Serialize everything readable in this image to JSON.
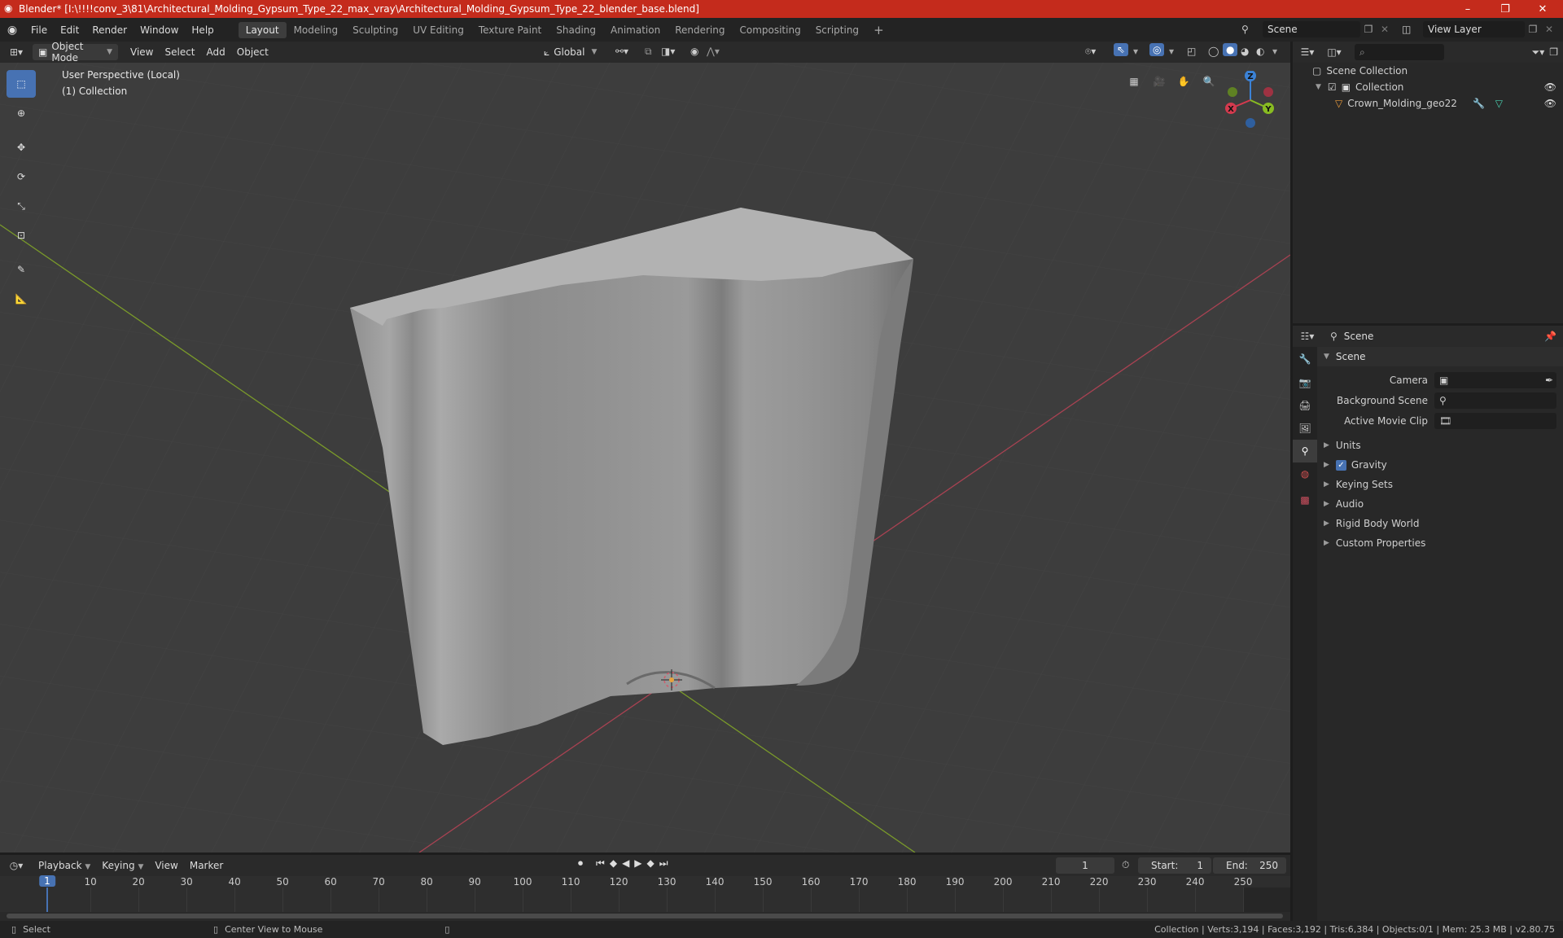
{
  "title_bar": {
    "title": "Blender* [I:\\!!!!conv_3\\81\\Architectural_Molding_Gypsum_Type_22_max_vray\\Architectural_Molding_Gypsum_Type_22_blender_base.blend]",
    "minimize": "–",
    "maximize": "❐",
    "close": "✕"
  },
  "menu": {
    "items": [
      "File",
      "Edit",
      "Render",
      "Window",
      "Help"
    ],
    "workspaces": [
      "Layout",
      "Modeling",
      "Sculpting",
      "UV Editing",
      "Texture Paint",
      "Shading",
      "Animation",
      "Rendering",
      "Compositing",
      "Scripting"
    ],
    "active_workspace": "Layout",
    "add_workspace": "+",
    "scene_label": "Scene",
    "view_layer_label": "View Layer"
  },
  "viewport_header": {
    "mode": "Object Mode",
    "menus": [
      "View",
      "Select",
      "Add",
      "Object"
    ],
    "orientation": "Global"
  },
  "viewport": {
    "perspective": "User Perspective (Local)",
    "collection": "(1) Collection",
    "gizmo_axes": {
      "x": "X",
      "y": "Y",
      "z": "Z"
    }
  },
  "outliner": {
    "root": "Scene Collection",
    "collection": "Collection",
    "object": "Crown_Molding_geo22"
  },
  "properties": {
    "header": "Scene",
    "panel": "Scene",
    "fields": [
      {
        "label": "Camera"
      },
      {
        "label": "Background Scene"
      },
      {
        "label": "Active Movie Clip"
      }
    ],
    "sections": [
      {
        "label": "Units",
        "checkbox": false
      },
      {
        "label": "Gravity",
        "checkbox": true
      },
      {
        "label": "Keying Sets",
        "checkbox": false
      },
      {
        "label": "Audio",
        "checkbox": false
      },
      {
        "label": "Rigid Body World",
        "checkbox": false
      },
      {
        "label": "Custom Properties",
        "checkbox": false
      }
    ]
  },
  "timeline": {
    "menus": [
      "Playback",
      "Keying",
      "View",
      "Marker"
    ],
    "current_frame": "1",
    "start_label": "Start:",
    "start": "1",
    "end_label": "End:",
    "end": "250",
    "ruler_marks": [
      1,
      10,
      20,
      30,
      40,
      50,
      60,
      70,
      80,
      90,
      100,
      110,
      120,
      130,
      140,
      150,
      160,
      170,
      180,
      190,
      200,
      210,
      220,
      230,
      240,
      250
    ]
  },
  "status_bar": {
    "select": "Select",
    "center_view": "Center View to Mouse",
    "stats": "Collection | Verts:3,194 | Faces:3,192 | Tris:6,384 | Objects:0/1 | Mem: 25.3 MB | v2.80.75"
  },
  "colors": {
    "title_bar": "#c42b1c",
    "active_tool": "#4772b3",
    "axis_x": "#d43a4e",
    "axis_y": "#88bb22",
    "axis_z": "#3b82d6",
    "frame_cursor": "#4772b3"
  }
}
